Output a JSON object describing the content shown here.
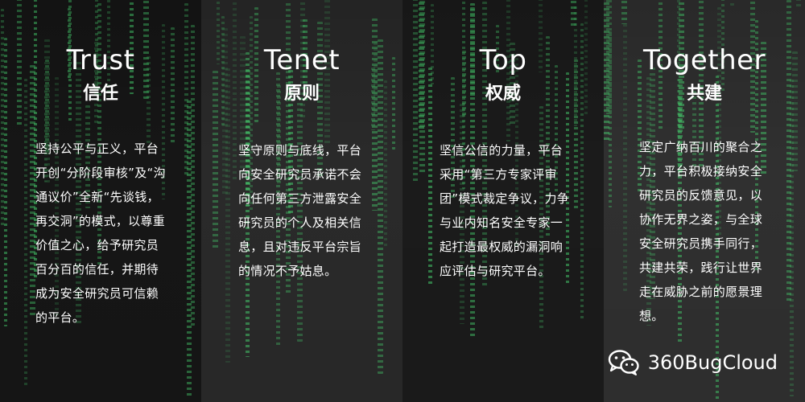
{
  "panels": [
    {
      "title": "Trust",
      "subtitle": "信任",
      "body": "坚持公平与正义，平台开创“分阶段审核”及“沟通议价”全新“先谈钱，再交洞”的模式，以尊重价值之心，给予研究员百分百的信任，并期待成为安全研究员可信赖的平台。"
    },
    {
      "title": "Tenet",
      "subtitle": "原则",
      "body": "坚守原则与底线，平台向安全研究员承诺不会向任何第三方泄露安全研究员的个人及相关信息，且对违反平台宗旨的情况不予姑息。"
    },
    {
      "title": "Top",
      "subtitle": "权威",
      "body": "坚信公信的力量，平台采用“第三方专家评审团”模式裁定争议，力争与业内知名安全专家一起打造最权威的漏洞响应评估与研究平台。"
    },
    {
      "title": "Together",
      "subtitle": "共建",
      "body": "坚定广纳百川的聚合之力，平台积极接纳安全研究员的反馈意见，以协作无界之姿，与全球安全研究员携手同行，共建共荣，践行让世界走在威胁之前的愿景理想。"
    }
  ],
  "watermark": {
    "icon": "wechat-icon",
    "text": "360BugCloud"
  }
}
